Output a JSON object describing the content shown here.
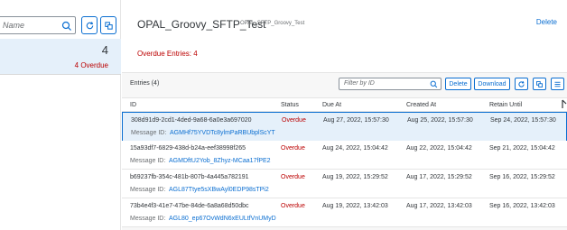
{
  "left_panel": {
    "search_placeholder": "Name",
    "selected_item": {
      "count": "4",
      "status": "4 Overdue"
    }
  },
  "header": {
    "title": "OPAL_Groovy_SFTP_Test",
    "subtitle": "OPAL_SFTP_Groovy_Test",
    "delete_label": "Delete",
    "overdue_entries": "Overdue Entries: 4"
  },
  "table": {
    "entries_label": "Entries (4)",
    "filter_placeholder": "Filter by ID",
    "delete_label": "Delete",
    "download_label": "Download",
    "columns": [
      "ID",
      "Status",
      "Due At",
      "Created At",
      "Retain Until"
    ],
    "message_id_label": "Message ID:",
    "rows": [
      {
        "id": "308d91d9-2cd1-4ded-9a68-6a0e3a697020",
        "status": "Overdue",
        "due_at": "Aug 27, 2022, 15:57:30",
        "created_at": "Aug 25, 2022, 15:57:30",
        "retain_until": "Sep 24, 2022, 15:57:30",
        "message_id": "AGMHf75YVDTc8ylmPaRBUbplScYT"
      },
      {
        "id": "15a93df7-6829-438d-b24a-eef38998f265",
        "status": "Overdue",
        "due_at": "Aug 24, 2022, 15:04:42",
        "created_at": "Aug 22, 2022, 15:04:42",
        "retain_until": "Sep 21, 2022, 15:04:42",
        "message_id": "AGMDftU2Yob_8Zhyz-MCaa17fPE2"
      },
      {
        "id": "b69237fb-354c-481b-807b-4a445a782191",
        "status": "Overdue",
        "due_at": "Aug 19, 2022, 15:29:52",
        "created_at": "Aug 17, 2022, 15:29:52",
        "retain_until": "Sep 16, 2022, 15:29:52",
        "message_id": "AGL87Ttye5sXBwAyl0EDP98sTPi2"
      },
      {
        "id": "73b4e4f3-41e7-47be-84de-6a8a68d50dbc",
        "status": "Overdue",
        "due_at": "Aug 19, 2022, 13:42:03",
        "created_at": "Aug 17, 2022, 13:42:03",
        "retain_until": "Sep 16, 2022, 13:42:03",
        "message_id": "AGL80_ep67OvWdN6xEULtfVnUMyD"
      }
    ]
  },
  "colors": {
    "accent": "#0a6ed1",
    "overdue": "#bb0000",
    "selected": "#e5f0fa"
  },
  "icons": [
    "search-icon",
    "refresh-icon",
    "sort-icon",
    "filter-search-icon",
    "table-settings-icon"
  ]
}
